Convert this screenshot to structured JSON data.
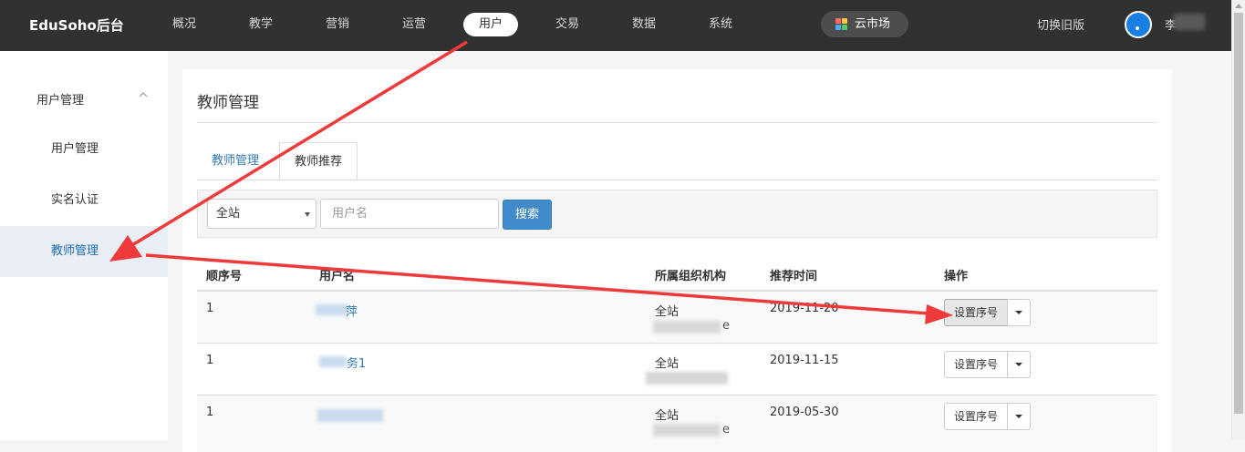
{
  "brand": "EduSoho后台",
  "nav": {
    "items": [
      "概况",
      "教学",
      "营销",
      "运营",
      "用户",
      "交易",
      "数据",
      "系统"
    ],
    "active_index": 4,
    "cloud_market": "云市场",
    "switch_old": "切换旧版",
    "username_visible": "李"
  },
  "sidebar": {
    "group_title": "用户管理",
    "items": [
      "用户管理",
      "实名认证",
      "教师管理"
    ],
    "active_index": 2
  },
  "main": {
    "title": "教师管理",
    "tabs": [
      "教师管理",
      "教师推荐"
    ],
    "active_tab_index": 1,
    "filter": {
      "select_value": "全站",
      "input_placeholder": "用户名",
      "search_label": "搜索"
    },
    "table": {
      "headers": [
        "顺序号",
        "用户名",
        "所属组织机构",
        "推荐时间",
        "操作"
      ],
      "rows": [
        {
          "order": "1",
          "username": "萍",
          "org": "全站",
          "org_sub": "e",
          "time": "2019-11-20",
          "action": "设置序号"
        },
        {
          "order": "1",
          "username": "务1",
          "org": "全站",
          "org_sub": "",
          "time": "2019-11-15",
          "action": "设置序号"
        },
        {
          "order": "1",
          "username": "",
          "org": "全站",
          "org_sub": "e",
          "time": "2019-05-30",
          "action": "设置序号"
        }
      ]
    }
  },
  "colors": {
    "topbar": "#313131",
    "link": "#337ab7",
    "primary_button": "#428bca",
    "annotation_arrow": "#ee3a3a",
    "sidebar_active_bg": "#e9eff5"
  }
}
